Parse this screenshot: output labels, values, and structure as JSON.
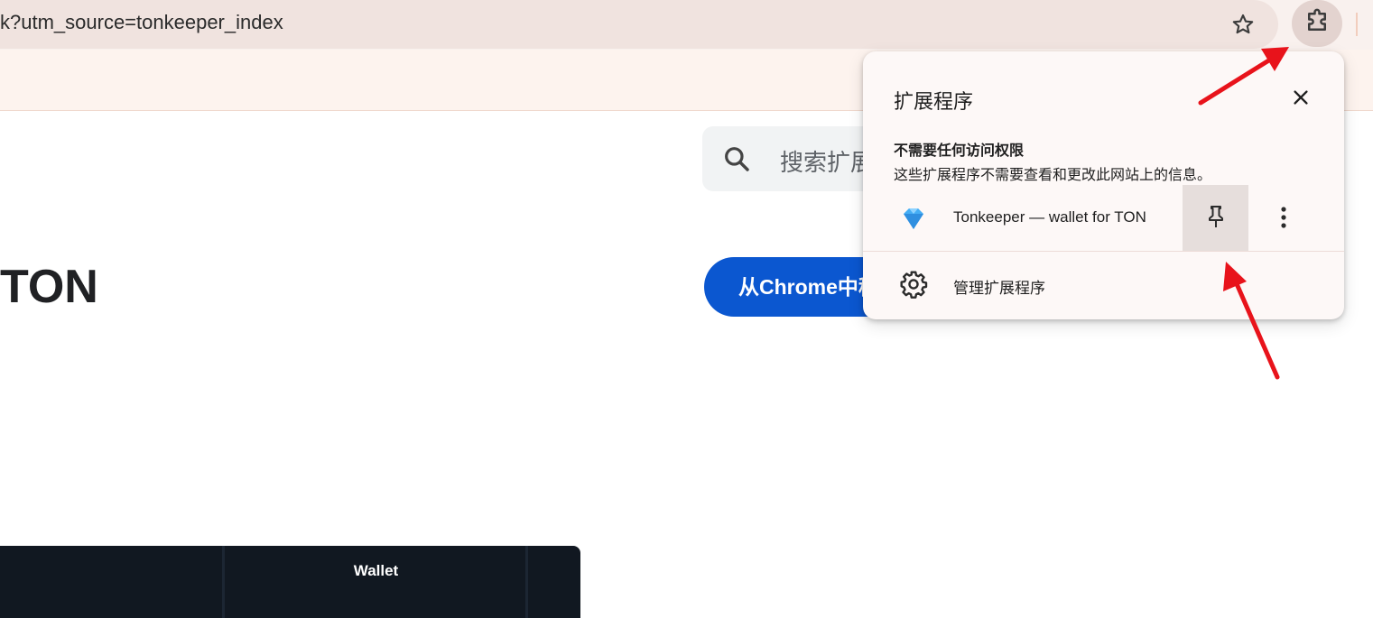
{
  "browser": {
    "url_text": "k?utm_source=tonkeeper_index",
    "icons": {
      "bookmark": "star-icon",
      "extensions": "puzzle-icon"
    }
  },
  "page": {
    "search_placeholder": "搜索扩展",
    "title": "TON",
    "add_button_label": "从Chrome中移除",
    "table_header": "Wallet",
    "colors": {
      "primary": "#0b57d0",
      "dark_panel": "#111821"
    }
  },
  "extensions_popup": {
    "title": "扩展程序",
    "section_title": "不需要任何访问权限",
    "section_desc": "这些扩展程序不需要查看和更改此网站上的信息。",
    "extension_name": "Tonkeeper — wallet for TON",
    "manage_label": "管理扩展程序",
    "icons": {
      "close": "close-icon",
      "pin": "pin-icon",
      "more": "more-vert-icon",
      "manage": "gear-icon",
      "extension": "tonkeeper-diamond-icon"
    }
  },
  "annotations": {
    "arrow_color": "#e8131b"
  }
}
